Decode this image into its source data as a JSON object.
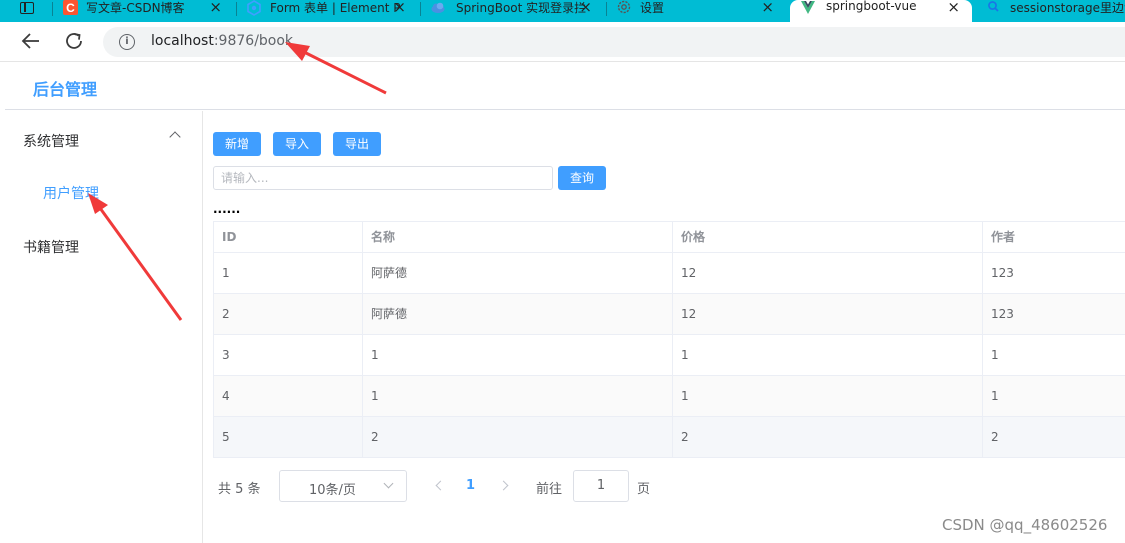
{
  "browser": {
    "tabs": [
      {
        "title": "写文章-CSDN博客",
        "active": false
      },
      {
        "title": "Form 表单 | Element Plus",
        "active": false
      },
      {
        "title": "SpringBoot 实现登录拦截",
        "active": false
      },
      {
        "title": "设置",
        "active": false
      },
      {
        "title": "springboot-vue",
        "active": true
      },
      {
        "title": "sessionstorage里边没",
        "active": false
      }
    ],
    "url_host": "localhost",
    "url_rest": ":9876/book"
  },
  "app": {
    "title": "后台管理"
  },
  "sidebar": {
    "group_label": "系统管理",
    "sub_item_label": "用户管理",
    "item_label": "书籍管理"
  },
  "toolbar": {
    "add_label": "新增",
    "import_label": "导入",
    "export_label": "导出",
    "search_placeholder": "请输入...",
    "search_label": "查询",
    "ellipsis": "......"
  },
  "table": {
    "headers": [
      "ID",
      "名称",
      "价格",
      "作者"
    ],
    "rows": [
      [
        "1",
        "阿萨德",
        "12",
        "123"
      ],
      [
        "2",
        "阿萨德",
        "12",
        "123"
      ],
      [
        "3",
        "1",
        "1",
        "1"
      ],
      [
        "4",
        "1",
        "1",
        "1"
      ],
      [
        "5",
        "2",
        "2",
        "2"
      ]
    ]
  },
  "pagination": {
    "total_text": "共 5 条",
    "page_size": "10条/页",
    "current_page": "1",
    "goto_label": "前往",
    "goto_value": "1",
    "page_unit": "页"
  },
  "watermark": "CSDN @qq_48602526",
  "colors": {
    "tabbar": "#00bcd4",
    "accent": "#409eff",
    "annotation_arrow": "#f03a3a"
  }
}
